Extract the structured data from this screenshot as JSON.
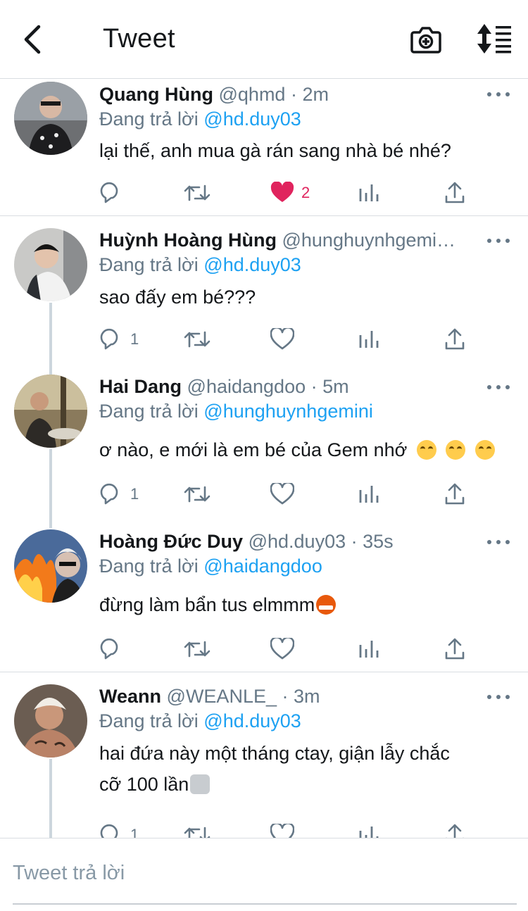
{
  "header": {
    "title": "Tweet",
    "back_icon": "chevron-left-icon",
    "camera_icon": "camera-plus-icon",
    "sort_icon": "sort-icon"
  },
  "colors": {
    "accent": "#1da1f2",
    "like_active": "#e0245e",
    "muted": "#657786",
    "divider": "#d9dde1",
    "text": "#14171a"
  },
  "tweets": [
    {
      "name": "Quang Hùng",
      "handle": "@qhmd",
      "time": "2m",
      "reply_label": "Đang trả lời",
      "reply_to": "@hd.duy03",
      "text": "lại thế, anh mua gà rán sang nhà bé nhé?",
      "reply_count": "",
      "like_count": "2",
      "liked": true
    },
    {
      "name": "Huỳnh Hoàng Hùng",
      "handle": "@hunghuynhgemi…",
      "time": "",
      "reply_label": "Đang trả lời",
      "reply_to": "@hd.duy03",
      "text": "sao đấy em bé???",
      "reply_count": "1",
      "like_count": "",
      "liked": false
    },
    {
      "name": "Hai Dang",
      "handle": "@haidangdoo",
      "time": "5m",
      "reply_label": "Đang trả lời",
      "reply_to": "@hunghuynhgemini",
      "text": "ơ nào, e mới là em bé của Gem nhớ",
      "reply_count": "1",
      "like_count": "",
      "liked": false
    },
    {
      "name": "Hoàng Đức Duy",
      "handle": "@hd.duy03",
      "time": "35s",
      "reply_label": "Đang trả lời",
      "reply_to": "@haidangdoo",
      "text": "đừng làm bẩn tus elmmm",
      "reply_count": "",
      "like_count": "",
      "liked": false
    },
    {
      "name": "Weann",
      "handle": "@WEANLE_",
      "time": "3m",
      "reply_label": "Đang trả lời",
      "reply_to": "@hd.duy03",
      "text_line1": "hai đứa này một tháng ctay, giận lẫy chắc",
      "text_line2": "cỡ 100 lần",
      "reply_count": "1",
      "like_count": "",
      "liked": false
    }
  ],
  "compose": {
    "placeholder": "Tweet trả lời"
  }
}
